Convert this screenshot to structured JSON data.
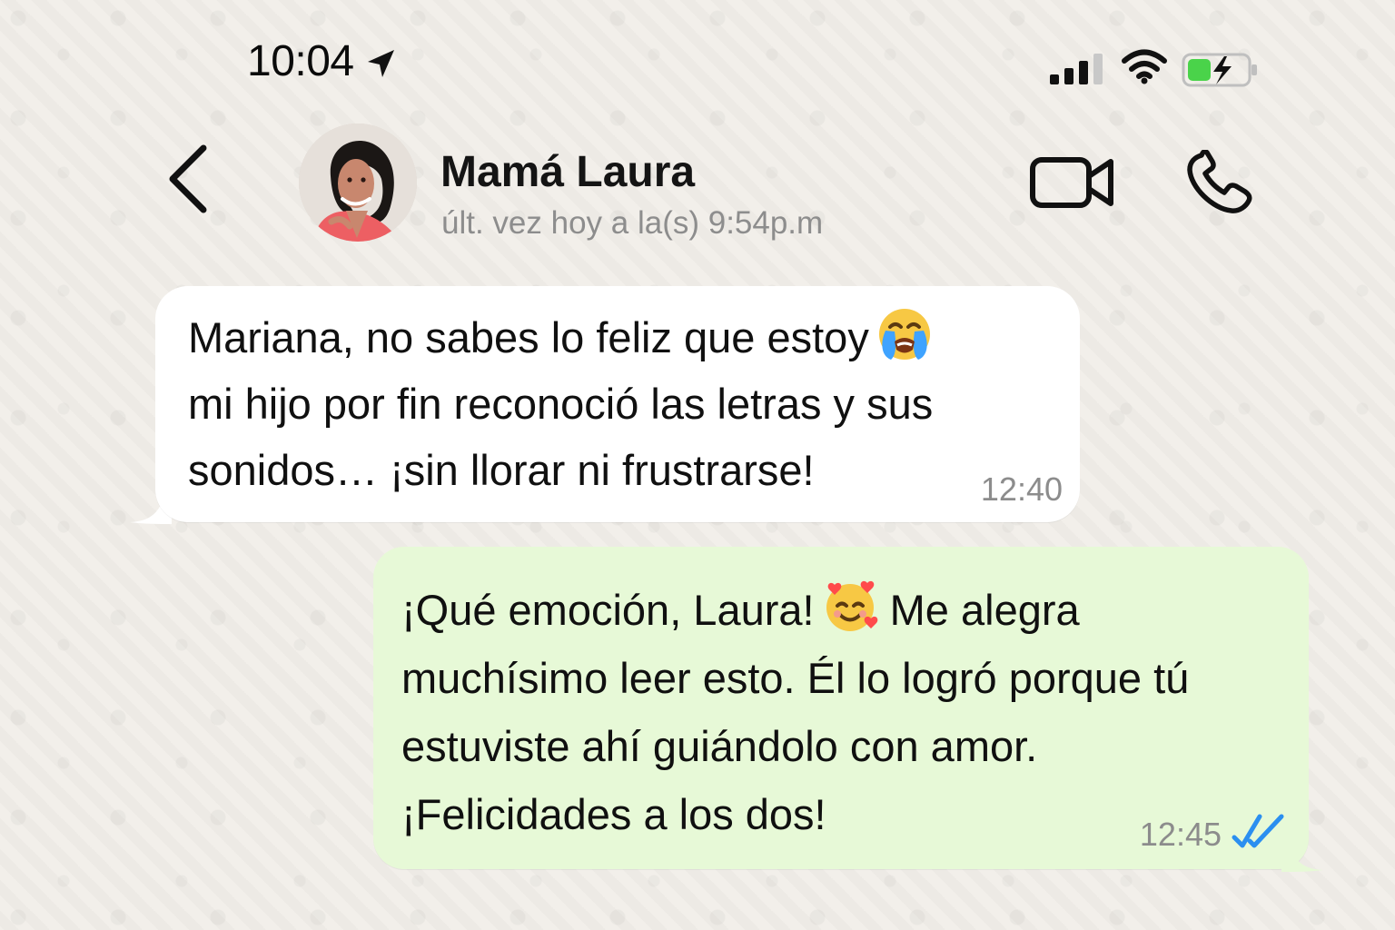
{
  "status_bar": {
    "time": "10:04"
  },
  "header": {
    "contact_name": "Mamá Laura",
    "last_seen": "últ. vez hoy a la(s) 9:54p.m"
  },
  "messages": [
    {
      "direction": "incoming",
      "line1": "Mariana, no sabes lo feliz que estoy",
      "emoji": "loudly-crying-face",
      "line2": "mi hijo por fin reconoció las letras y sus",
      "line3": "sonidos… ¡sin llorar ni frustrarse!",
      "time": "12:40"
    },
    {
      "direction": "outgoing",
      "line1_start": "¡Qué emoción, Laura!",
      "emoji": "smiling-face-with-hearts",
      "line1_end": "Me alegra",
      "line2": "muchísimo leer esto. Él lo logró porque tú",
      "line3": "estuviste ahí guiándolo con amor.",
      "line4": "¡Felicidades a los dos!",
      "time": "12:45",
      "read_receipt": "double-check-blue"
    }
  ],
  "colors": {
    "background": "#f2efea",
    "incoming_bubble": "#ffffff",
    "outgoing_bubble": "#e7f9d7",
    "read_receipt": "#2b8ff0",
    "battery_fill": "#4ad34a"
  }
}
